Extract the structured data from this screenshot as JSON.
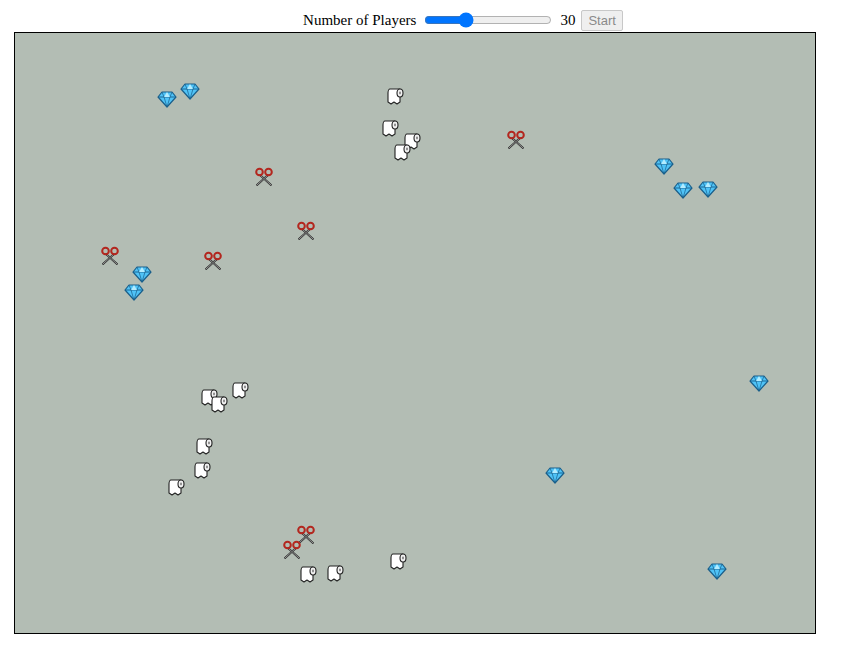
{
  "controls": {
    "label": "Number of Players",
    "level": 0.3,
    "value": "30",
    "button": {
      "label": "Start",
      "disabled": true
    }
  },
  "players": [
    {
      "kind": "rock"
    },
    {
      "kind": "rock"
    },
    {
      "kind": "rock"
    },
    {
      "kind": "rock"
    },
    {
      "kind": "rock"
    },
    {
      "kind": "rock"
    },
    {
      "kind": "rock"
    },
    {
      "kind": "rock"
    },
    {
      "kind": "rock"
    },
    {
      "kind": "rock"
    },
    {
      "kind": "paper"
    },
    {
      "kind": "paper"
    },
    {
      "kind": "paper"
    },
    {
      "kind": "paper"
    },
    {
      "kind": "paper"
    },
    {
      "kind": "paper"
    },
    {
      "kind": "paper"
    },
    {
      "kind": "paper"
    },
    {
      "kind": "paper"
    },
    {
      "kind": "paper"
    },
    {
      "kind": "paper"
    },
    {
      "kind": "paper"
    },
    {
      "kind": "paper"
    },
    {
      "kind": "scissors"
    },
    {
      "kind": "scissors"
    },
    {
      "kind": "scissors"
    },
    {
      "kind": "scissors"
    },
    {
      "kind": "scissors"
    },
    {
      "kind": "scissors"
    },
    {
      "kind": "scissors"
    }
  ]
}
